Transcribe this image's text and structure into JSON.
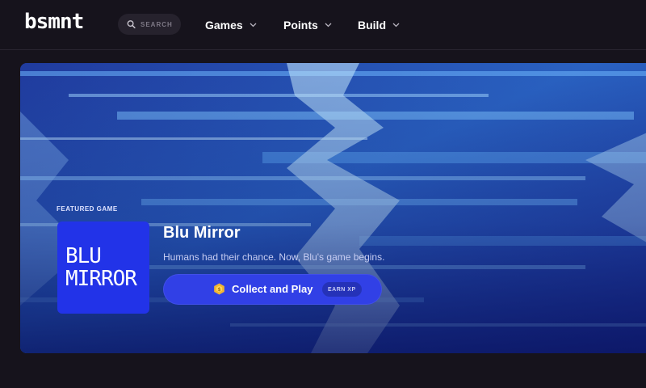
{
  "brand": {
    "logo_text": "bsmnt"
  },
  "search": {
    "placeholder": "SEARCH"
  },
  "nav": {
    "items": [
      {
        "label": "Games"
      },
      {
        "label": "Points"
      },
      {
        "label": "Build"
      }
    ]
  },
  "hero": {
    "featured_label": "FEATURED GAME",
    "tile": {
      "line1": "BLU",
      "line2": "MIRROR"
    },
    "title": "Blu Mirror",
    "description": "Humans had their chance. Now, Blu's game begins.",
    "cta": {
      "label": "Collect and Play",
      "badge": "EARN XP"
    }
  },
  "colors": {
    "background": "#16131c",
    "accent": "#3140e6",
    "tile": "#2233e8",
    "coin": "#f2b632"
  },
  "icons": [
    "search-icon",
    "chevron-down-icon",
    "coin-icon"
  ]
}
